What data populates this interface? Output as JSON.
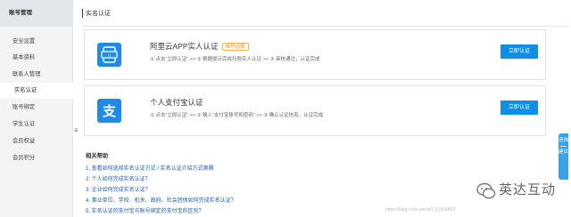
{
  "sidebar": {
    "header": "账号管理",
    "items": [
      {
        "label": "安全设置",
        "active": false
      },
      {
        "label": "基本资料",
        "active": false
      },
      {
        "label": "联系人管理",
        "active": false
      },
      {
        "label": "实名认证",
        "active": true
      },
      {
        "label": "账号绑定",
        "active": false
      },
      {
        "label": "学生认证",
        "active": false
      },
      {
        "label": "会员权益",
        "active": false
      },
      {
        "label": "会员积分",
        "active": false
      }
    ],
    "toggle_glyph": "≡"
  },
  "main": {
    "title": "实名认证",
    "cards": [
      {
        "title": "阿里云APP实人认证",
        "badge": "推荐选择",
        "steps": "① 点击“立即认证” >> ② 根据提示完成扫脸实人认证 >> ③ 审核通过，认证完成",
        "button": "立即认证",
        "icon": "aliyun-app-icon"
      },
      {
        "title": "个人支付宝认证",
        "steps": "① 点击“立即认证” >> ② 输入“支付宝账号和密码” >> ③ 确认认证信息，认证完成",
        "button": "立即认证",
        "icon": "alipay-icon"
      }
    ],
    "help": {
      "title": "相关帮助",
      "links": [
        "1. 查看如何选择实名认证方式 / 实名认证介绍方式奥腾",
        "2. 个人如何完成实名认证？",
        "3. 企业如何完成实名认证？",
        "4. 事业单位、学校、机关、政府、社会团体如何完成实名认证？",
        "5. 实名认证的支付宝与账号绑定的支付宝的区别？"
      ]
    }
  },
  "float_tab": {
    "items": [
      "咨询",
      "建议"
    ]
  },
  "watermark": {
    "text": "英达互动",
    "url": "https://blog.csdn.net/m0_51914809"
  },
  "colors": {
    "accent": "#0f8ee6",
    "badge": "#f39a1d",
    "link": "#1b5fb3"
  }
}
